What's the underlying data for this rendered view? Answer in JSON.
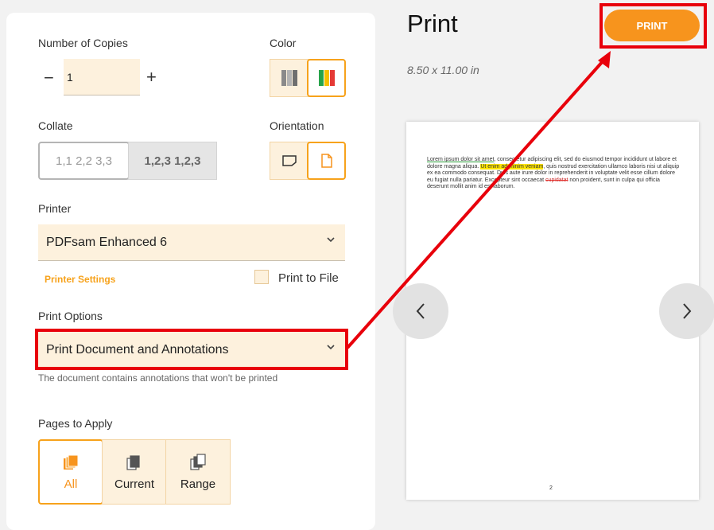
{
  "copies": {
    "label": "Number of Copies",
    "value": "1",
    "minus": "−",
    "plus": "+"
  },
  "color": {
    "label": "Color",
    "options": [
      "grayscale-icon",
      "color-icon"
    ],
    "selected": "color"
  },
  "collate": {
    "label": "Collate",
    "option_uncollated": "1,1 2,2 3,3",
    "option_collated": "1,2,3 1,2,3"
  },
  "orientation": {
    "label": "Orientation",
    "options": [
      "landscape-icon",
      "portrait-icon"
    ],
    "selected": "portrait"
  },
  "printer": {
    "label": "Printer",
    "selected": "PDFsam Enhanced 6",
    "settings_link": "Printer Settings",
    "print_to_file": "Print to File"
  },
  "print_options": {
    "label": "Print Options",
    "selected": "Print Document and Annotations",
    "note": "The document contains annotations that won't be printed"
  },
  "pages": {
    "label": "Pages to Apply",
    "all": "All",
    "current": "Current",
    "range": "Range"
  },
  "header": {
    "title": "Print",
    "dimensions": "8.50 x 11.00 in",
    "print_button": "PRINT"
  },
  "preview": {
    "text_part1": "Lorem ipsum dolor sit amet",
    "text_part2": ", consectetur adipiscing elit, sed do eiusmod tempor incididunt ut labore et dolore magna aliqua. ",
    "highlight": "Ut enim ad minim veniam",
    "text_part3": ", quis nostrud exercitation ullamco laboris nisi ut aliquip ex ea commodo consequat. Duis aute irure dolor in reprehenderit in voluptate velit esse cillum dolore eu fugiat nulla pariatur. Excepteur sint occaecat ",
    "strike": "cupidatat",
    "text_part4": " non proident, sunt in culpa qui officia deserunt mollit anim id est laborum.",
    "page_number": "2"
  },
  "colors": {
    "accent": "#f7941d",
    "field_bg": "#fdf1dd",
    "annotation_red": "#e8000b"
  }
}
